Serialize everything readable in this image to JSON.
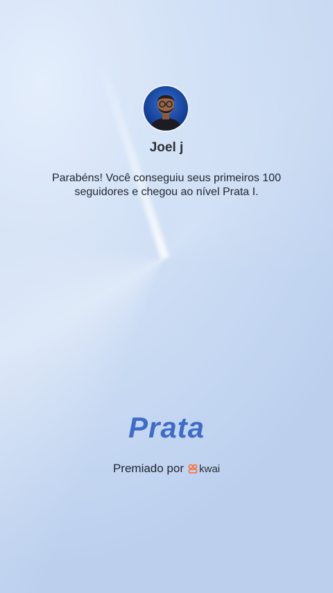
{
  "profile": {
    "name": "Joel j"
  },
  "achievement": {
    "message": "Parabéns! Você conseguiu seus primeiros 100 seguidores e chegou ao nível Prata I.",
    "level": "Prata"
  },
  "footer": {
    "awarded_by": "Premiado por",
    "brand": "kwai",
    "brand_color": "#ff6a2b"
  },
  "colors": {
    "level_text": "#3e6cc6"
  }
}
